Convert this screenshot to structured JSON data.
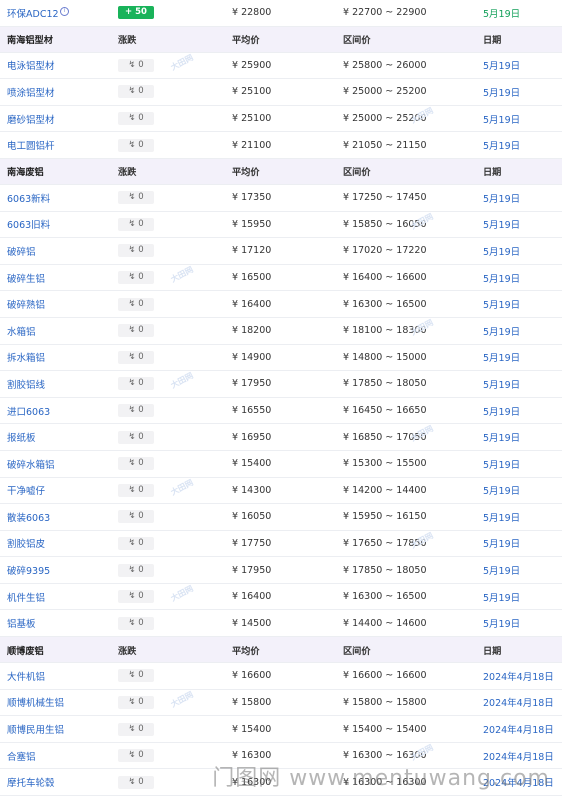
{
  "rows": [
    {
      "kind": "data",
      "name": "环保ADC12",
      "has_icon": true,
      "icon": "info-circle-icon",
      "change": "+ 50",
      "change_up": true,
      "avg": "¥ 22800",
      "range": "¥ 22700 ~ 22900",
      "date": "5月19日",
      "date_green": true
    },
    {
      "kind": "header",
      "name": "南海铝型材",
      "change": "涨跌",
      "avg": "平均价",
      "range": "区间价",
      "date": "日期"
    },
    {
      "kind": "data",
      "name": "电泳铝型材",
      "change": "↯ 0",
      "avg": "¥ 25900",
      "range": "¥ 25800 ~ 26000",
      "date": "5月19日"
    },
    {
      "kind": "data",
      "name": "喷涂铝型材",
      "change": "↯ 0",
      "avg": "¥ 25100",
      "range": "¥ 25000 ~ 25200",
      "date": "5月19日"
    },
    {
      "kind": "data",
      "name": "磨砂铝型材",
      "change": "↯ 0",
      "avg": "¥ 25100",
      "range": "¥ 25000 ~ 25200",
      "date": "5月19日"
    },
    {
      "kind": "data",
      "name": "电工圆铝杆",
      "change": "↯ 0",
      "avg": "¥ 21100",
      "range": "¥ 21050 ~ 21150",
      "date": "5月19日"
    },
    {
      "kind": "header",
      "name": "南海废铝",
      "change": "涨跌",
      "avg": "平均价",
      "range": "区间价",
      "date": "日期"
    },
    {
      "kind": "data",
      "name": "6063新料",
      "change": "↯ 0",
      "avg": "¥ 17350",
      "range": "¥ 17250 ~ 17450",
      "date": "5月19日"
    },
    {
      "kind": "data",
      "name": "6063旧料",
      "change": "↯ 0",
      "avg": "¥ 15950",
      "range": "¥ 15850 ~ 16050",
      "date": "5月19日"
    },
    {
      "kind": "data",
      "name": "破碎铝",
      "change": "↯ 0",
      "avg": "¥ 17120",
      "range": "¥ 17020 ~ 17220",
      "date": "5月19日"
    },
    {
      "kind": "data",
      "name": "破碎生铝",
      "change": "↯ 0",
      "avg": "¥ 16500",
      "range": "¥ 16400 ~ 16600",
      "date": "5月19日"
    },
    {
      "kind": "data",
      "name": "破碎熟铝",
      "change": "↯ 0",
      "avg": "¥ 16400",
      "range": "¥ 16300 ~ 16500",
      "date": "5月19日"
    },
    {
      "kind": "data",
      "name": "水箱铝",
      "change": "↯ 0",
      "avg": "¥ 18200",
      "range": "¥ 18100 ~ 18300",
      "date": "5月19日"
    },
    {
      "kind": "data",
      "name": "拆水箱铝",
      "change": "↯ 0",
      "avg": "¥ 14900",
      "range": "¥ 14800 ~ 15000",
      "date": "5月19日"
    },
    {
      "kind": "data",
      "name": "割胶铝线",
      "change": "↯ 0",
      "avg": "¥ 17950",
      "range": "¥ 17850 ~ 18050",
      "date": "5月19日"
    },
    {
      "kind": "data",
      "name": "进口6063",
      "change": "↯ 0",
      "avg": "¥ 16550",
      "range": "¥ 16450 ~ 16650",
      "date": "5月19日"
    },
    {
      "kind": "data",
      "name": "报纸板",
      "change": "↯ 0",
      "avg": "¥ 16950",
      "range": "¥ 16850 ~ 17050",
      "date": "5月19日"
    },
    {
      "kind": "data",
      "name": "破碎水箱铝",
      "change": "↯ 0",
      "avg": "¥ 15400",
      "range": "¥ 15300 ~ 15500",
      "date": "5月19日"
    },
    {
      "kind": "data",
      "name": "干净嘘仔",
      "change": "↯ 0",
      "avg": "¥ 14300",
      "range": "¥ 14200 ~ 14400",
      "date": "5月19日"
    },
    {
      "kind": "data",
      "name": "散装6063",
      "change": "↯ 0",
      "avg": "¥ 16050",
      "range": "¥ 15950 ~ 16150",
      "date": "5月19日"
    },
    {
      "kind": "data",
      "name": "割胶铝皮",
      "change": "↯ 0",
      "avg": "¥ 17750",
      "range": "¥ 17650 ~ 17850",
      "date": "5月19日"
    },
    {
      "kind": "data",
      "name": "破碎9395",
      "change": "↯ 0",
      "avg": "¥ 17950",
      "range": "¥ 17850 ~ 18050",
      "date": "5月19日"
    },
    {
      "kind": "data",
      "name": "机件生铝",
      "change": "↯ 0",
      "avg": "¥ 16400",
      "range": "¥ 16300 ~ 16500",
      "date": "5月19日"
    },
    {
      "kind": "data",
      "name": "铝基板",
      "change": "↯ 0",
      "avg": "¥ 14500",
      "range": "¥ 14400 ~ 14600",
      "date": "5月19日"
    },
    {
      "kind": "header",
      "name": "顺博废铝",
      "change": "涨跌",
      "avg": "平均价",
      "range": "区间价",
      "date": "日期"
    },
    {
      "kind": "data",
      "name": "大件机铝",
      "change": "↯ 0",
      "avg": "¥ 16600",
      "range": "¥ 16600 ~ 16600",
      "date": "2024年4月18日"
    },
    {
      "kind": "data",
      "name": "顺博机械生铝",
      "change": "↯ 0",
      "avg": "¥ 15800",
      "range": "¥ 15800 ~ 15800",
      "date": "2024年4月18日"
    },
    {
      "kind": "data",
      "name": "顺博民用生铝",
      "change": "↯ 0",
      "avg": "¥ 15400",
      "range": "¥ 15400 ~ 15400",
      "date": "2024年4月18日"
    },
    {
      "kind": "data",
      "name": "合塞铝",
      "change": "↯ 0",
      "avg": "¥ 16300",
      "range": "¥ 16300 ~ 16300",
      "date": "2024年4月18日"
    },
    {
      "kind": "data",
      "name": "摩托车轮毂",
      "change": "↯ 0",
      "avg": "¥ 16300",
      "range": "¥ 16300 ~ 16300",
      "date": "2024年4月18日"
    }
  ],
  "watermarks": {
    "row_mark": "大田网",
    "site": "门图网 www.mentuwang.com"
  },
  "colors": {
    "link": "#2a66c4",
    "header_bg": "#f3f1fa",
    "up_badge": "#19b35a",
    "green_date": "#13a05a"
  }
}
